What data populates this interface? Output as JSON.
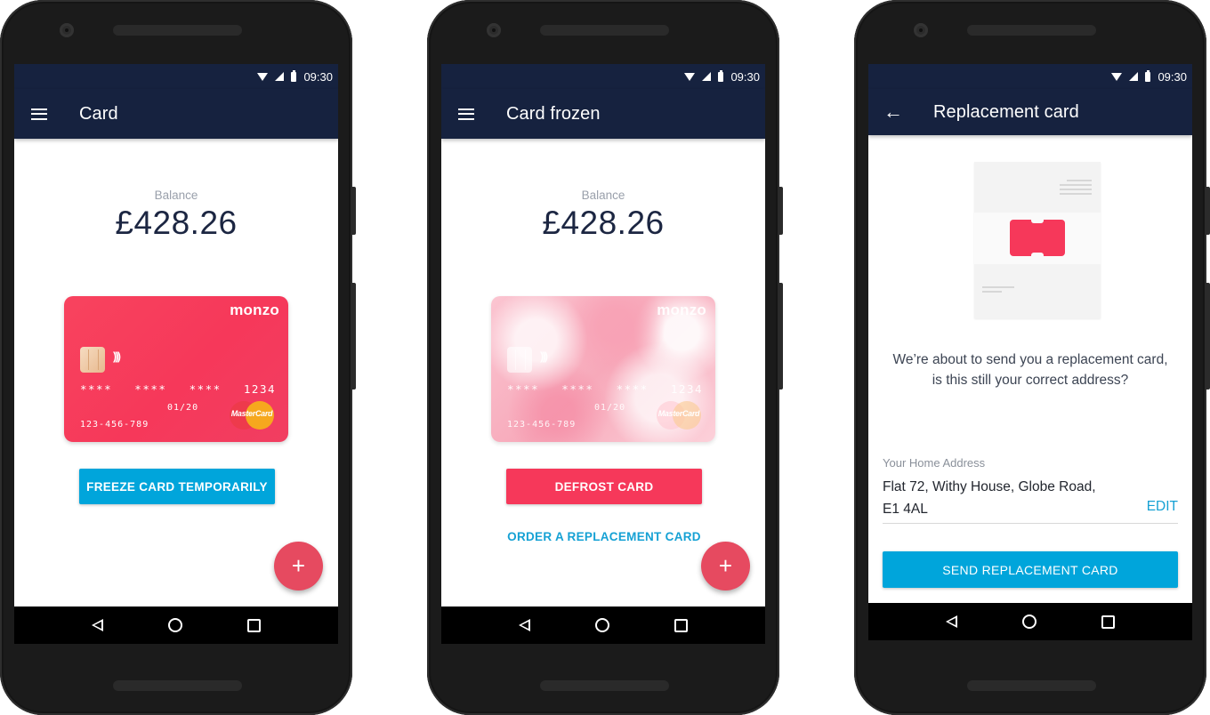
{
  "status_bar": {
    "time": "09:30"
  },
  "colors": {
    "app_bar": "#16223f",
    "accent_blue": "#00a5db",
    "accent_red": "#f6385a",
    "fab": "#e64a60",
    "link": "#15a1d4"
  },
  "screens": [
    {
      "title": "Card",
      "nav_icon": "menu-icon",
      "balance_label": "Balance",
      "balance_amount": "£428.26",
      "card": {
        "brand": "monzo",
        "number_groups": [
          "****",
          "****",
          "****",
          "1234"
        ],
        "expiry": "01/20",
        "account": "123-456-789",
        "network": "MasterCard",
        "state": "active"
      },
      "primary_button": "FREEZE CARD TEMPORARILY",
      "fab_label": "+"
    },
    {
      "title": "Card frozen",
      "nav_icon": "menu-icon",
      "balance_label": "Balance",
      "balance_amount": "£428.26",
      "card": {
        "brand": "monzo",
        "number_groups": [
          "****",
          "****",
          "****",
          "1234"
        ],
        "expiry": "01/20",
        "account": "123-456-789",
        "network": "MasterCard",
        "state": "frozen"
      },
      "primary_button": "DEFROST CARD",
      "secondary_link": "ORDER A REPLACEMENT CARD",
      "fab_label": "+"
    },
    {
      "title": "Replacement card",
      "nav_icon": "back-arrow-icon",
      "back_glyph": "←",
      "prompt": "We’re about to send you a replacement card, is this still your correct address?",
      "address_label": "Your Home Address",
      "address_line1": "Flat 72, Withy House, Globe Road,",
      "address_line2": "E1 4AL",
      "edit_label": "EDIT",
      "primary_button": "SEND REPLACEMENT CARD"
    }
  ]
}
